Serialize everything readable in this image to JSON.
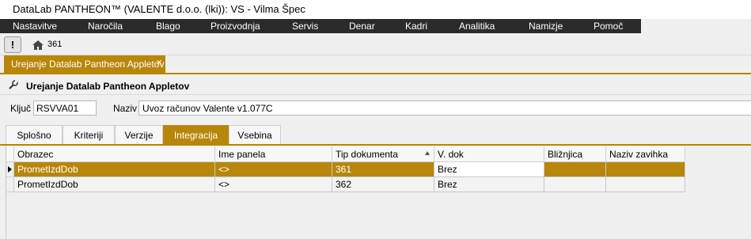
{
  "window": {
    "title": "DataLab PANTHEON™  (VALENTE d.o.o. (lki)): VS - Vilma Špec"
  },
  "menu": [
    {
      "label": "Nastavitve"
    },
    {
      "label": "Naročila"
    },
    {
      "label": "Blago"
    },
    {
      "label": "Proizvodnja"
    },
    {
      "label": "Servis"
    },
    {
      "label": "Denar"
    },
    {
      "label": "Kadri"
    },
    {
      "label": "Analitika"
    },
    {
      "label": "Namizje"
    },
    {
      "label": "Pomoč"
    }
  ],
  "toolbar": {
    "alert_label": "!",
    "home_count": "361"
  },
  "doc_tab": {
    "label": "Urejanje Datalab Pantheon Appletov",
    "close": "×"
  },
  "panel": {
    "title": "Urejanje Datalab Pantheon Appletov"
  },
  "form": {
    "kljuc_label": "Ključ",
    "kljuc_value": "RSVVA01",
    "naziv_label": "Naziv",
    "naziv_value": "Uvoz računov Valente v1.077C"
  },
  "tabs": [
    {
      "label": "Splošno"
    },
    {
      "label": "Kriteriji"
    },
    {
      "label": "Verzije"
    },
    {
      "label": "Integracija",
      "active": true
    },
    {
      "label": "Vsebina"
    }
  ],
  "grid": {
    "columns": [
      "Obrazec",
      "Ime panela",
      "Tip dokumenta",
      "V. dok",
      "Bližnjica",
      "Naziv zavihka"
    ],
    "sorted_column": "Tip dokumenta",
    "rows": [
      {
        "obrazec": "PrometIzdDob",
        "ime_panela": "<>",
        "tip": "361",
        "vdok": "Brez",
        "bliznjica": "",
        "naziv_zavihka": "",
        "selected": true
      },
      {
        "obrazec": "PrometIzdDob",
        "ime_panela": "<>",
        "tip": "362",
        "vdok": "Brez",
        "bliznjica": "",
        "naziv_zavihka": "",
        "selected": false
      }
    ]
  },
  "colors": {
    "accent": "#b8860b",
    "menubar": "#2b2b2b"
  },
  "icons": [
    "alert-button",
    "home-icon",
    "close-icon",
    "wrench-icon",
    "sort-ascending-icon",
    "row-pointer-icon"
  ]
}
